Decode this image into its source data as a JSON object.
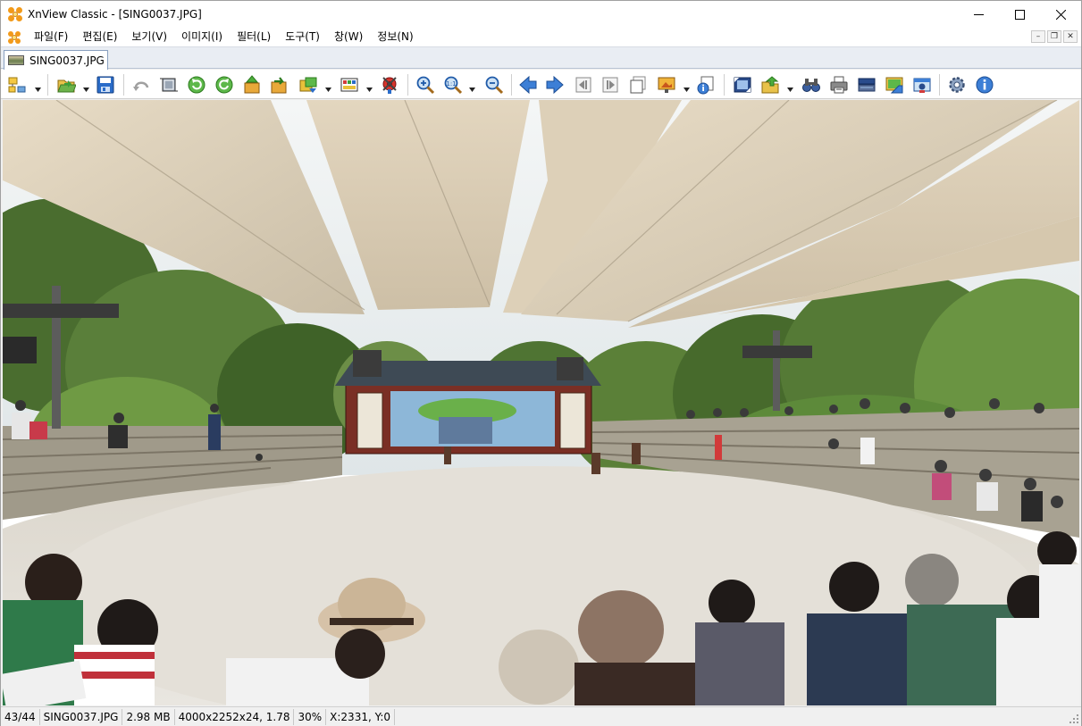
{
  "window": {
    "title": "XnView Classic - [SING0037.JPG]",
    "accent": "#f29a1a"
  },
  "menu": {
    "items": [
      "파일(F)",
      "편집(E)",
      "보기(V)",
      "이미지(I)",
      "필터(L)",
      "도구(T)",
      "창(W)",
      "정보(N)"
    ]
  },
  "tabs": [
    {
      "label": "SING0037.JPG",
      "active": true
    }
  ],
  "toolbar": {
    "icons": [
      "browser-icon",
      "open-folder-icon",
      "save-icon",
      "undo-icon",
      "crop-icon",
      "rotate-left-icon",
      "rotate-right-icon",
      "flip-icon",
      "auto-rotate-icon",
      "convert-icon",
      "adjust-colors-icon",
      "red-eye-icon",
      "zoom-in-icon",
      "zoom-icon",
      "zoom-out-icon",
      "previous-icon",
      "next-icon",
      "first-icon",
      "last-icon",
      "slideshow-icon",
      "properties-icon",
      "fullscreen-icon",
      "export-icon",
      "find-icon",
      "print-icon",
      "scanner-icon",
      "capture-icon",
      "webcam-icon",
      "settings-icon",
      "info-icon"
    ]
  },
  "image": {
    "filename": "SING0037.JPG",
    "description_colors": {
      "sky": "#e9eef0",
      "canopy": "#ddd2bd",
      "trees": "#4c6e33",
      "ground": "#e6e2db",
      "steps": "#9a9484"
    }
  },
  "status": {
    "position": "43/44",
    "filename": "SING0037.JPG",
    "filesize": "2.98 MB",
    "dimensions": "4000x2252x24, 1.78",
    "zoom": "30%",
    "coords": "X:2331, Y:0"
  }
}
